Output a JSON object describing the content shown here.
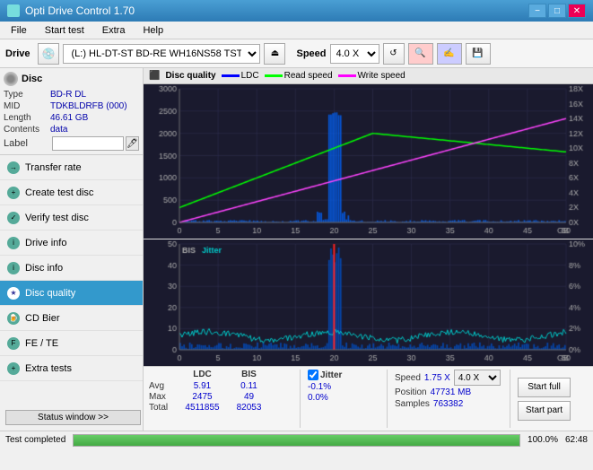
{
  "titlebar": {
    "title": "Opti Drive Control 1.70",
    "minimize": "−",
    "maximize": "□",
    "close": "✕"
  },
  "menu": {
    "items": [
      "File",
      "Start test",
      "Extra",
      "Help"
    ]
  },
  "toolbar": {
    "drive_label": "Drive",
    "drive_value": "(L:) HL-DT-ST BD-RE  WH16NS58 TST4",
    "speed_label": "Speed",
    "speed_value": "4.0 X"
  },
  "disc": {
    "header": "Disc",
    "type_label": "Type",
    "type_value": "BD-R DL",
    "mid_label": "MID",
    "mid_value": "TDKBLDRFB (000)",
    "length_label": "Length",
    "length_value": "46.61 GB",
    "contents_label": "Contents",
    "contents_value": "data",
    "label_label": "Label"
  },
  "nav": {
    "items": [
      {
        "id": "transfer-rate",
        "label": "Transfer rate",
        "active": false
      },
      {
        "id": "create-test-disc",
        "label": "Create test disc",
        "active": false
      },
      {
        "id": "verify-test-disc",
        "label": "Verify test disc",
        "active": false
      },
      {
        "id": "drive-info",
        "label": "Drive info",
        "active": false
      },
      {
        "id": "disc-info",
        "label": "Disc info",
        "active": false
      },
      {
        "id": "disc-quality",
        "label": "Disc quality",
        "active": true
      },
      {
        "id": "cd-bier",
        "label": "CD Bier",
        "active": false
      },
      {
        "id": "fe-te",
        "label": "FE / TE",
        "active": false
      },
      {
        "id": "extra-tests",
        "label": "Extra tests",
        "active": false
      }
    ],
    "status_window": "Status window >>"
  },
  "chart": {
    "title": "Disc quality",
    "legend": {
      "ldc": "LDC",
      "read_speed": "Read speed",
      "write_speed": "Write speed"
    },
    "top": {
      "y_max": 3000,
      "y_right_max": 18,
      "x_max": 50,
      "y_right_unit": "X"
    },
    "bottom": {
      "title": "BIS",
      "legend2": "Jitter",
      "y_max": 50,
      "y_right_max": 10,
      "x_max": 50,
      "y_right_unit": "%"
    }
  },
  "stats": {
    "col_ldc": "LDC",
    "col_bis": "BIS",
    "col_jitter": "Jitter",
    "col_speed": "Speed",
    "col_pos": "Position",
    "col_samples": "Samples",
    "avg_label": "Avg",
    "max_label": "Max",
    "total_label": "Total",
    "avg_ldc": "5.91",
    "avg_bis": "0.11",
    "avg_jitter": "-0.1%",
    "max_ldc": "2475",
    "max_bis": "49",
    "max_jitter": "0.0%",
    "total_ldc": "4511855",
    "total_bis": "82053",
    "speed_val": "1.75 X",
    "speed_select": "4.0 X",
    "position_val": "47731 MB",
    "samples_val": "763382",
    "start_full": "Start full",
    "start_part": "Start part"
  },
  "statusbar": {
    "text": "Test completed",
    "progress": "100.0%",
    "time": "62:48"
  }
}
